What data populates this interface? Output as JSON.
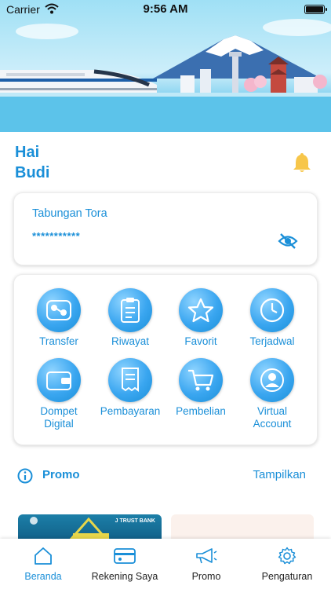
{
  "status_bar": {
    "carrier": "Carrier",
    "time": "9:56 AM"
  },
  "greeting": {
    "line1": "Hai",
    "line2": "Budi"
  },
  "savings": {
    "title": "Tabungan Tora",
    "masked_balance": "***********"
  },
  "menu": [
    {
      "label": "Transfer",
      "icon": "transfer-icon"
    },
    {
      "label": "Riwayat",
      "icon": "clipboard-icon"
    },
    {
      "label": "Favorit",
      "icon": "star-icon"
    },
    {
      "label": "Terjadwal",
      "icon": "clock-icon"
    },
    {
      "label": "Dompet\nDigital",
      "icon": "wallet-icon"
    },
    {
      "label": "Pembayaran",
      "icon": "receipt-icon"
    },
    {
      "label": "Pembelian",
      "icon": "cart-icon"
    },
    {
      "label": "Virtual\nAccount",
      "icon": "user-account-icon"
    }
  ],
  "promo": {
    "title": "Promo",
    "more_label": "Tampilkan"
  },
  "promo_cards": [
    {
      "brand": "J TRUST BANK"
    }
  ],
  "tabs": [
    {
      "label": "Beranda",
      "icon": "home-icon",
      "active": true
    },
    {
      "label": "Rekening Saya",
      "icon": "card-icon",
      "active": false
    },
    {
      "label": "Promo",
      "icon": "megaphone-icon",
      "active": false
    },
    {
      "label": "Pengaturan",
      "icon": "gear-icon",
      "active": false
    }
  ],
  "colors": {
    "accent": "#1a8fd8",
    "bell": "#f7c64a",
    "icon_light": "#8fd4ff"
  }
}
